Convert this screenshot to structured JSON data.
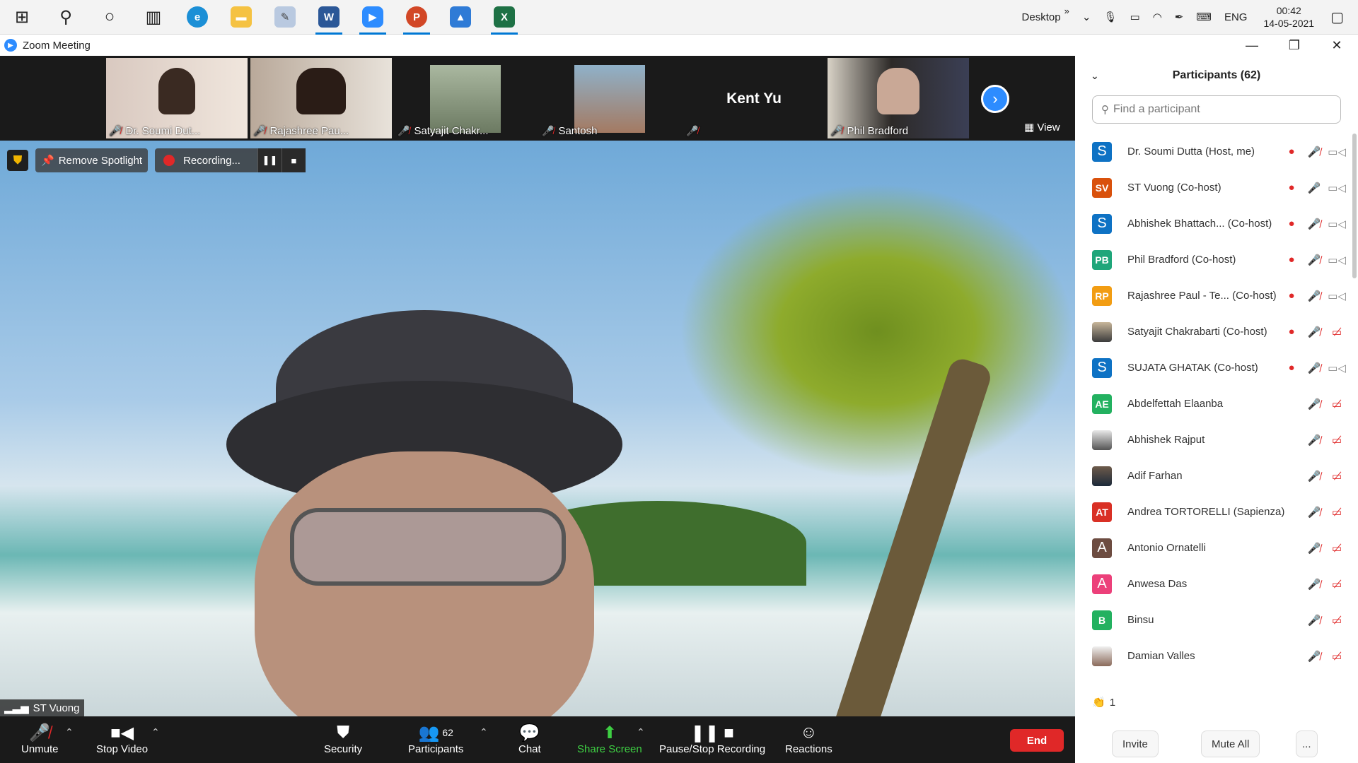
{
  "taskbar": {
    "desktop_label": "Desktop",
    "lang": "ENG",
    "time": "00:42",
    "date": "14-05-2021",
    "more": "»"
  },
  "window": {
    "title": "Zoom Meeting"
  },
  "gallery": {
    "thumbs": [
      {
        "name": "Dr. Soumi Dut..."
      },
      {
        "name": "Rajashree Pau..."
      },
      {
        "name": "Satyajit Chakr..."
      },
      {
        "name": "Santosh"
      },
      {
        "name": "Kent Yu"
      },
      {
        "name": "Phil Bradford"
      }
    ],
    "view_label": "View"
  },
  "main": {
    "remove_spotlight": "Remove Spotlight",
    "recording": "Recording...",
    "speaker": "ST Vuong"
  },
  "toolbar": {
    "unmute": "Unmute",
    "stop_video": "Stop Video",
    "security": "Security",
    "participants": "Participants",
    "participants_count": "62",
    "chat": "Chat",
    "share_screen": "Share Screen",
    "pause_stop_recording": "Pause/Stop Recording",
    "reactions": "Reactions",
    "end": "End"
  },
  "panel": {
    "title": "Participants (62)",
    "search_placeholder": "Find a participant",
    "participants": [
      {
        "initials": "S",
        "name": "Dr. Soumi Dutta (Host, me)",
        "color": "#0e72c4"
      },
      {
        "initials": "SV",
        "name": "ST Vuong (Co-host)",
        "color": "#d9510c"
      },
      {
        "initials": "S",
        "name": "Abhishek Bhattach...  (Co-host)",
        "color": "#0e72c4"
      },
      {
        "initials": "PB",
        "name": "Phil Bradford (Co-host)",
        "color": "#1fa67a"
      },
      {
        "initials": "RP",
        "name": "Rajashree Paul - Te...  (Co-host)",
        "color": "#f29d13"
      },
      {
        "initials": "",
        "name": "Satyajit Chakrabarti (Co-host)",
        "color": ""
      },
      {
        "initials": "S",
        "name": "SUJATA GHATAK (Co-host)",
        "color": "#0e72c4"
      },
      {
        "initials": "AE",
        "name": "Abdelfettah Elaanba",
        "color": "#23b160"
      },
      {
        "initials": "",
        "name": "Abhishek Rajput",
        "color": ""
      },
      {
        "initials": "",
        "name": "Adif Farhan",
        "color": ""
      },
      {
        "initials": "AT",
        "name": "Andrea TORTORELLI (Sapienza)",
        "color": "#d93025"
      },
      {
        "initials": "A",
        "name": "Antonio Ornatelli",
        "color": "#6d4c41"
      },
      {
        "initials": "A",
        "name": "Anwesa Das",
        "color": "#ec407a"
      },
      {
        "initials": "B",
        "name": "Binsu",
        "color": "#23b160"
      },
      {
        "initials": "",
        "name": "Damian Valles",
        "color": ""
      }
    ],
    "reaction_count": "1",
    "invite": "Invite",
    "mute_all": "Mute All",
    "more": "..."
  }
}
